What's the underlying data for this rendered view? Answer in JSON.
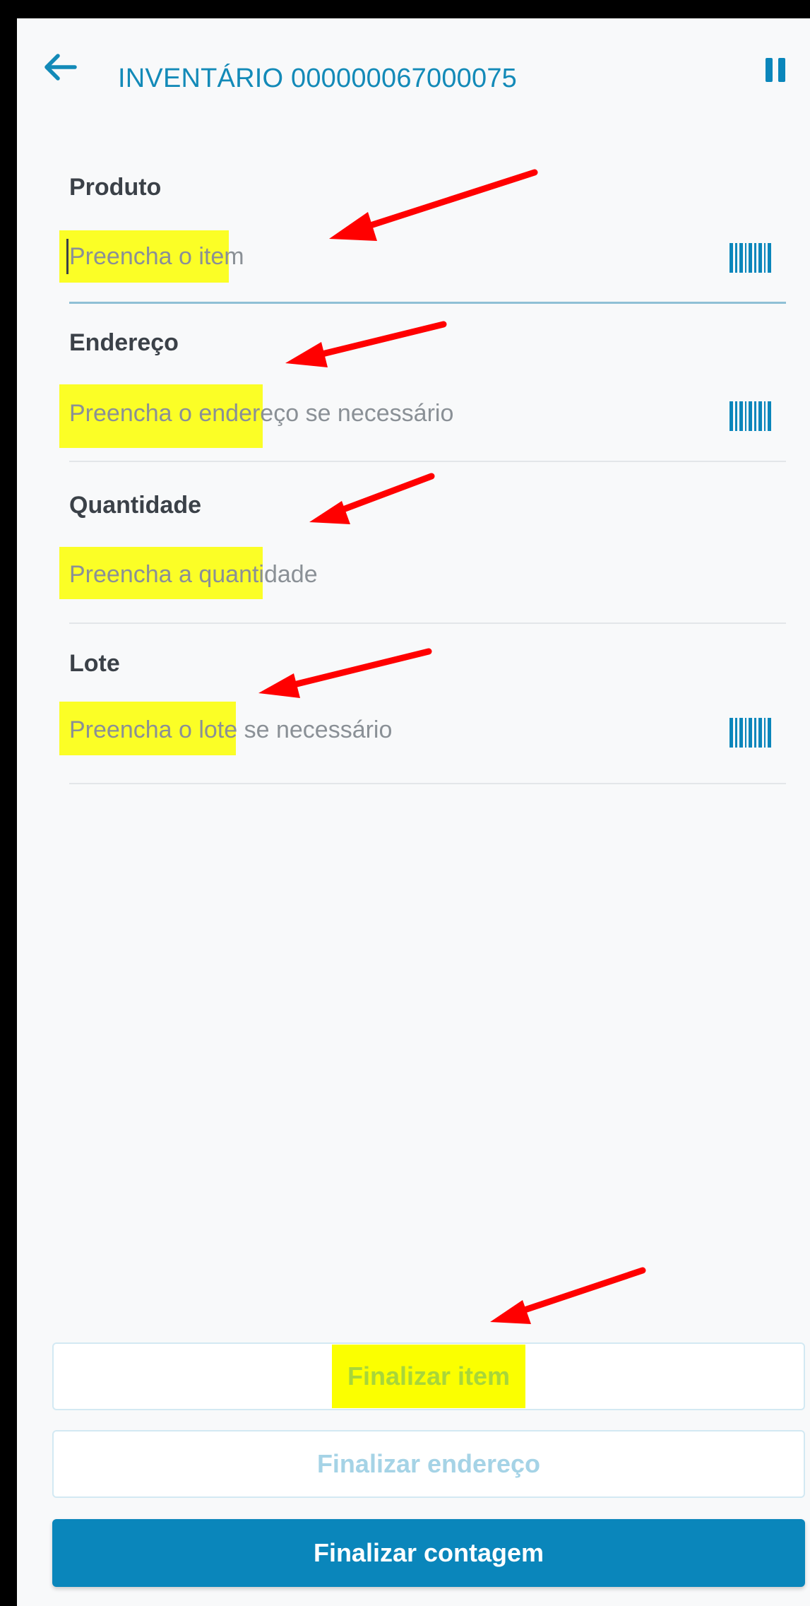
{
  "header": {
    "title": "INVENTÁRIO 000000067000075"
  },
  "fields": {
    "produto": {
      "label": "Produto",
      "placeholder": "Preencha o item"
    },
    "endereco": {
      "label": "Endereço",
      "placeholder": "Preencha o endereço se necessário"
    },
    "quantidade": {
      "label": "Quantidade",
      "placeholder": "Preencha a quantidade"
    },
    "lote": {
      "label": "Lote",
      "placeholder": "Preencha o lote se necessário"
    }
  },
  "actions": {
    "finalizar_item": "Finalizar item",
    "finalizar_endereco": "Finalizar endereço",
    "finalizar_contagem": "Finalizar contagem"
  },
  "colors": {
    "accent": "#0a86bb",
    "title": "#138ab8",
    "highlight": "#fbff00",
    "annotation_arrow": "#ff0000"
  },
  "icons": {
    "back": "arrow-left-icon",
    "pause": "pause-icon",
    "scan": "barcode-icon"
  }
}
